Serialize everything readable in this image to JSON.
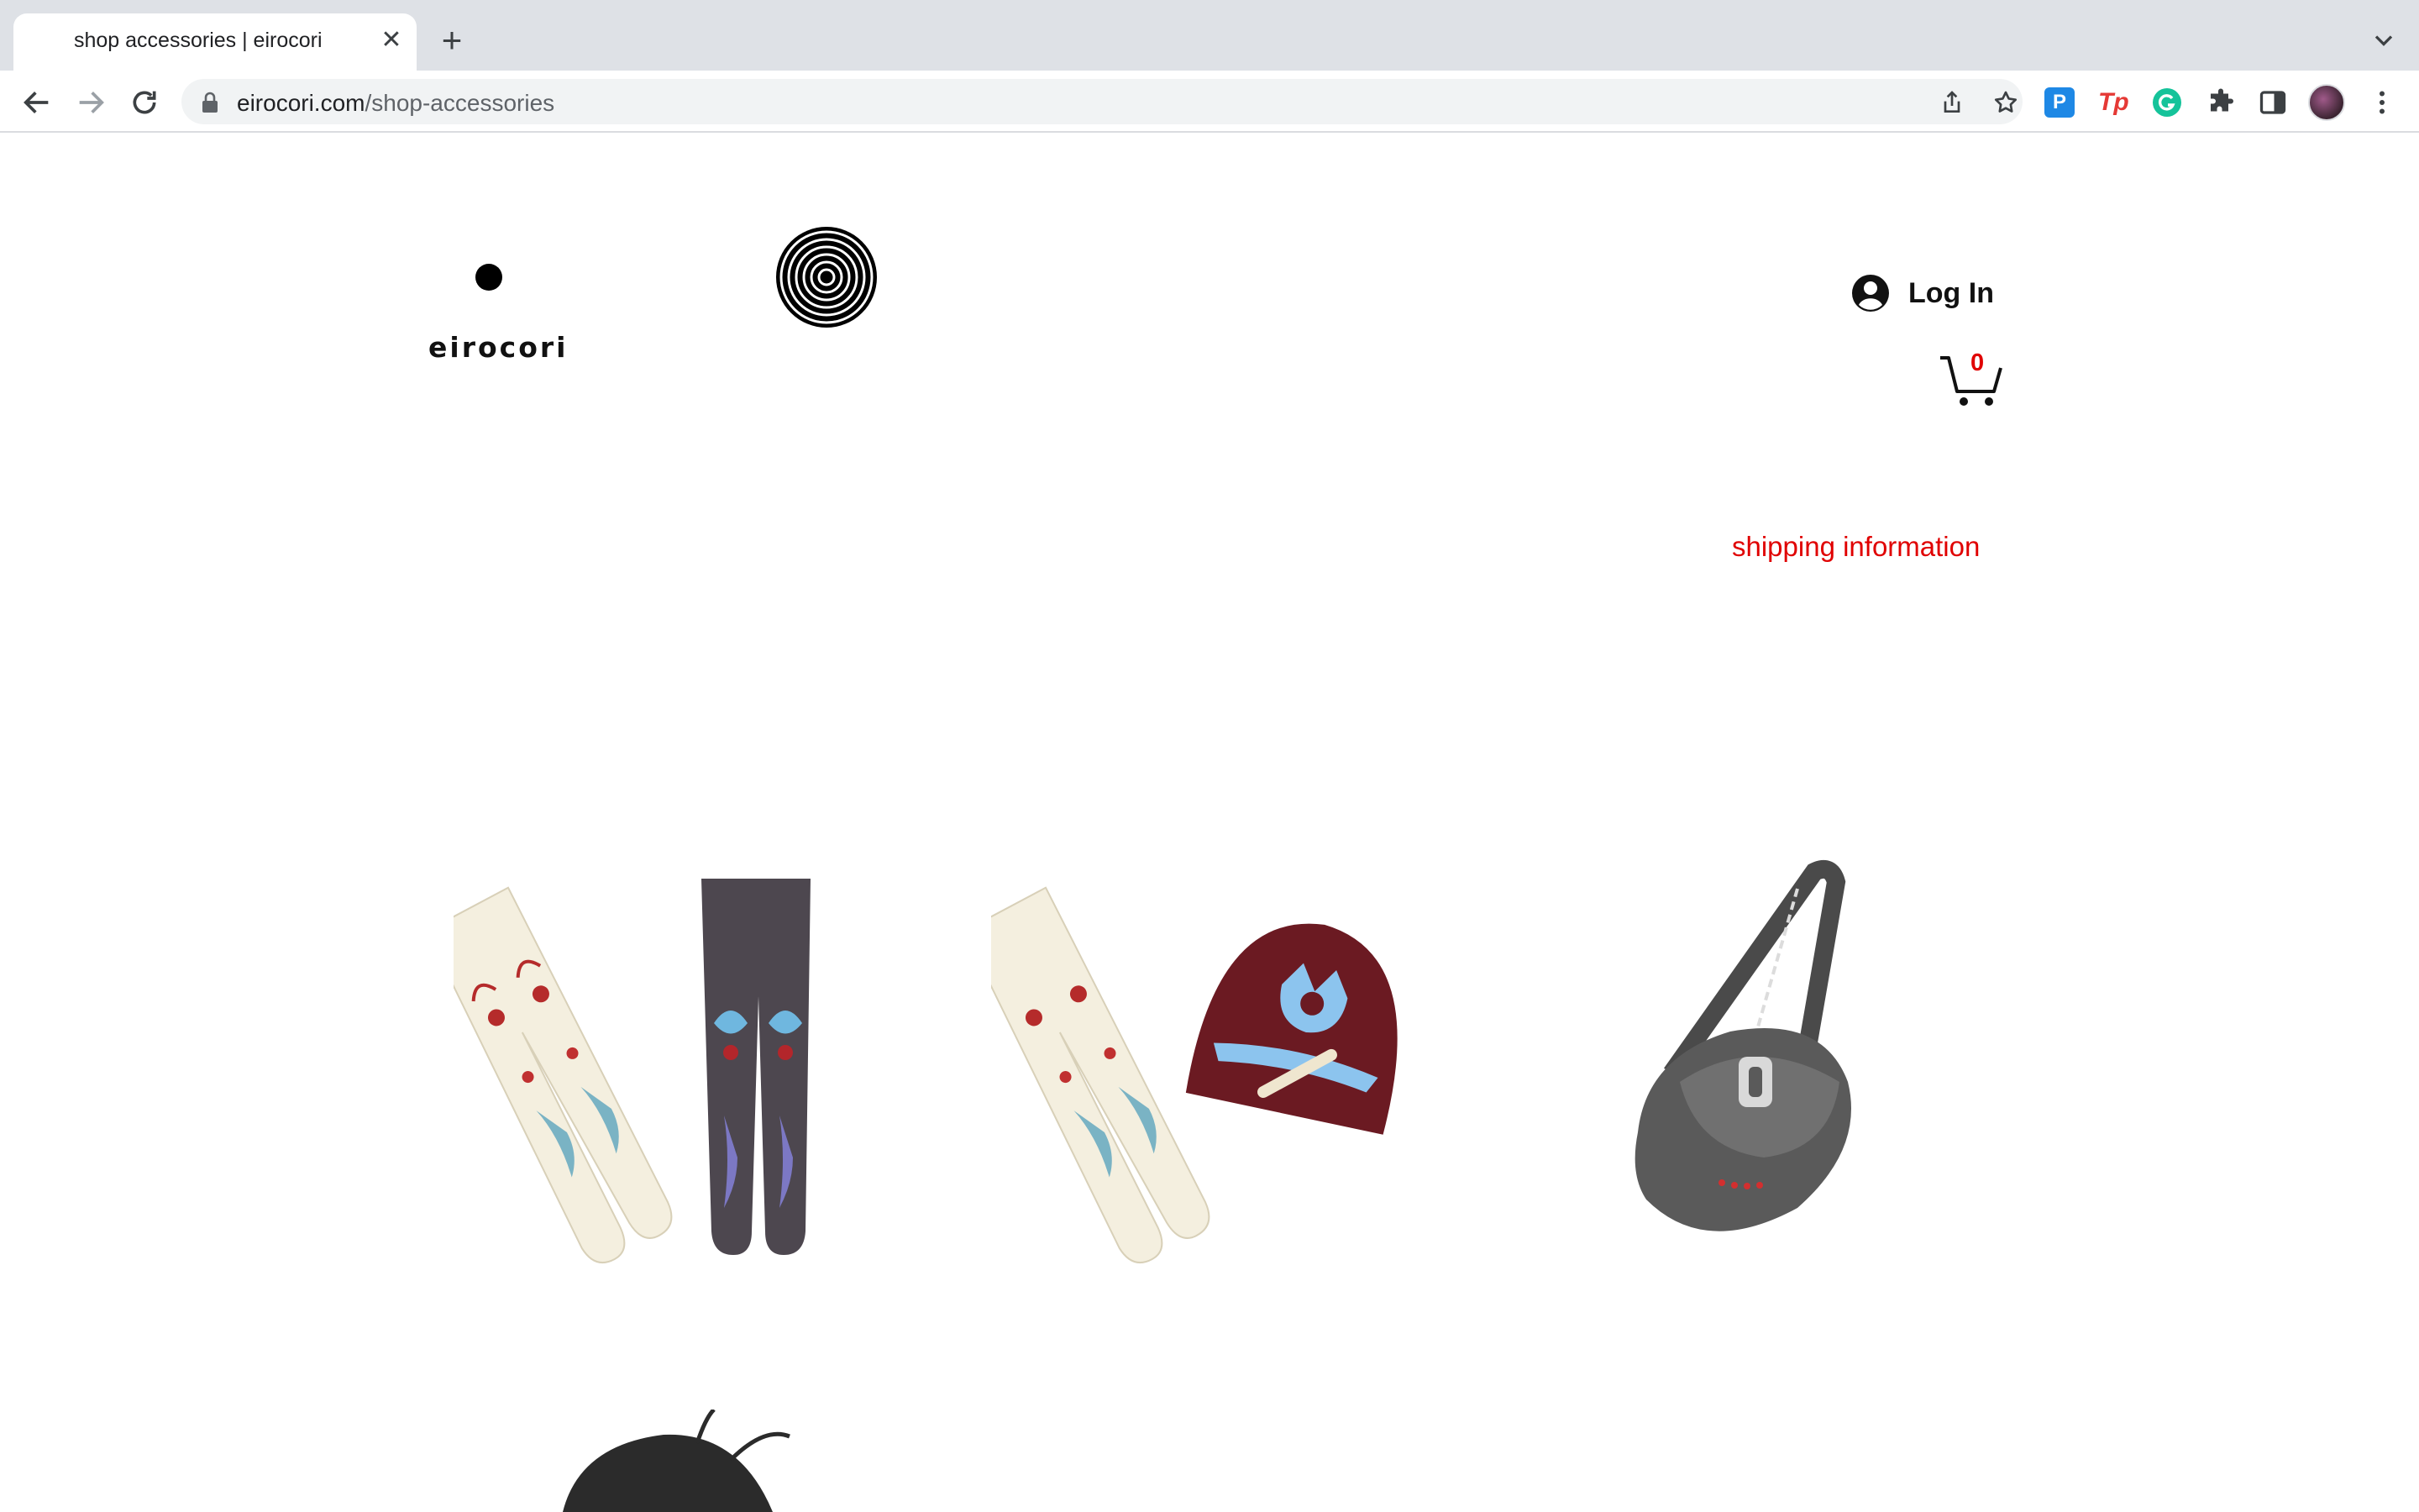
{
  "browser": {
    "tab_title": "shop accessories | eirocori",
    "url_host": "eirocori.com",
    "url_path": "/shop-accessories"
  },
  "header": {
    "logo_text": "eirocori",
    "login_label": "Log In",
    "cart_count": "0"
  },
  "links": {
    "shipping": "shipping information"
  },
  "colors": {
    "accent": "#e00000",
    "tabstrip": "#dee1e6"
  },
  "products": [
    {
      "name": "printed-tights-pair"
    },
    {
      "name": "tights-and-beanie"
    },
    {
      "name": "grey-shoulder-bag"
    },
    {
      "name": "black-hat-partial"
    }
  ]
}
